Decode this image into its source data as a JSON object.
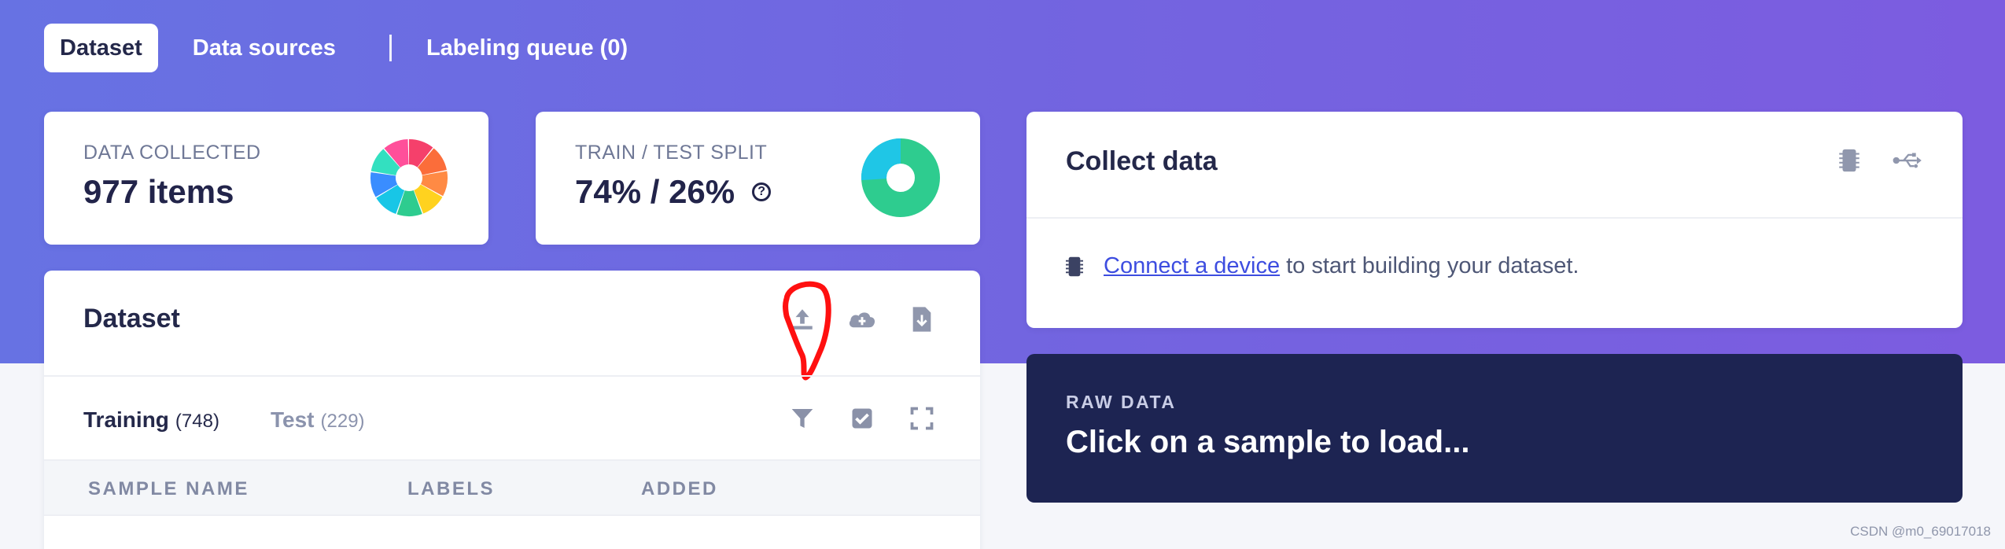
{
  "nav": {
    "tabs": [
      {
        "label": "Dataset",
        "active": true
      },
      {
        "label": "Data sources",
        "active": false
      },
      {
        "label": "Labeling queue (0)",
        "active": false
      }
    ]
  },
  "stats": {
    "data_collected": {
      "label": "DATA COLLECTED",
      "value": "977 items"
    },
    "train_test_split": {
      "label": "TRAIN / TEST SPLIT",
      "value": "74% / 26%",
      "train_fraction": 0.74,
      "test_fraction": 0.26
    }
  },
  "dataset_panel": {
    "title": "Dataset",
    "toolbar_icons": [
      "upload-icon",
      "cloud-upload-icon",
      "download-file-icon"
    ],
    "tabs": [
      {
        "label": "Training",
        "count": "(748)",
        "active": true
      },
      {
        "label": "Test",
        "count": "(229)",
        "active": false
      }
    ],
    "list_icons": [
      "filter-icon",
      "checkbox-icon",
      "expand-icon"
    ],
    "columns": [
      "SAMPLE NAME",
      "LABELS",
      "ADDED"
    ]
  },
  "collect_data": {
    "title": "Collect data",
    "header_icons": [
      "chip-icon",
      "usb-icon"
    ],
    "link_text": "Connect a device",
    "suffix_text": "to start building your dataset."
  },
  "raw_data": {
    "label": "RAW DATA",
    "message": "Click on a sample to load..."
  },
  "watermark": "CSDN @m0_69017018",
  "colors": {
    "hero_gradient_start": "#6772e3",
    "hero_gradient_end": "#7c5ce0",
    "raw_card_bg": "#1d2452",
    "link": "#3d4de0",
    "train_color": "#2ecc8f",
    "test_color": "#1fc6e6",
    "annotation_red": "#ff1010"
  }
}
